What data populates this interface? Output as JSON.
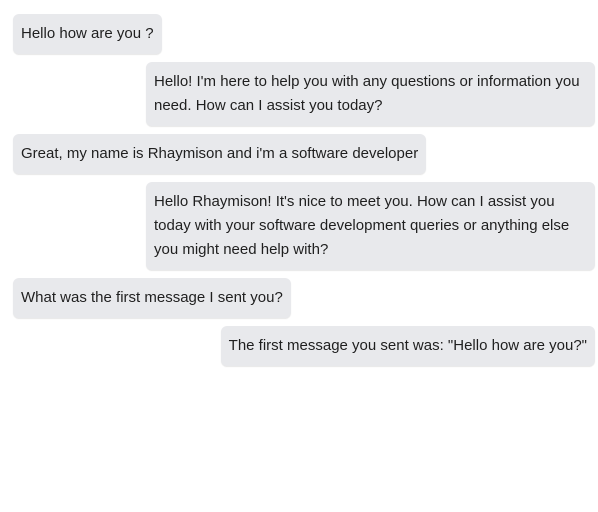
{
  "messages": [
    {
      "role": "user",
      "text": "Hello how are you ?"
    },
    {
      "role": "assistant",
      "text": "Hello! I'm here to help you with any questions or information you need. How can I assist you today?"
    },
    {
      "role": "user",
      "text": "Great, my name is Rhaymison and i'm a software developer"
    },
    {
      "role": "assistant",
      "text": "Hello Rhaymison! It's nice to meet you. How can I assist you today with your software development queries or anything else you might need help with?"
    },
    {
      "role": "user",
      "text": "What was the first message I sent you?"
    },
    {
      "role": "assistant",
      "text": "The first message you sent was: \"Hello how are you?\""
    }
  ]
}
